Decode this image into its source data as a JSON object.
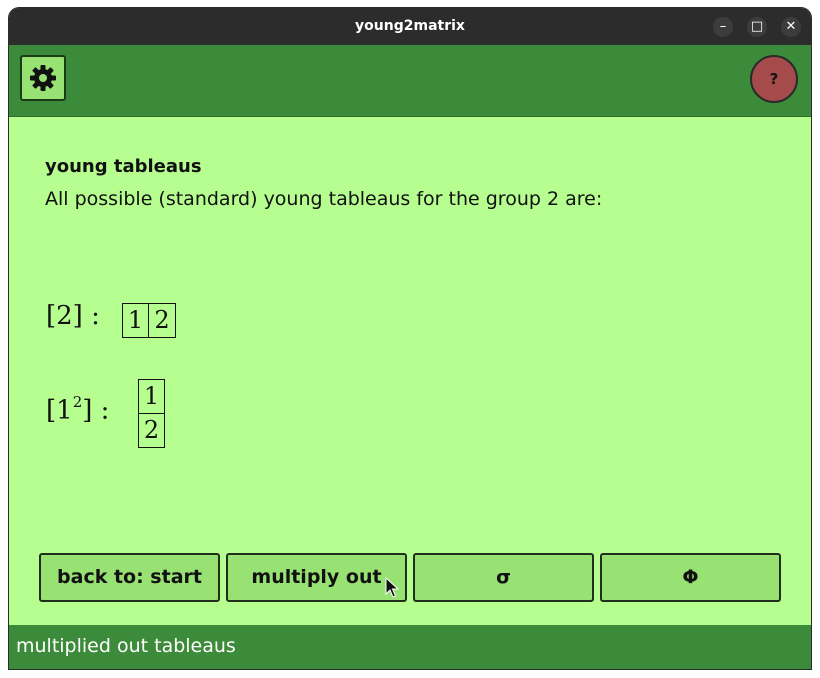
{
  "window": {
    "title": "young2matrix",
    "minimize_glyph": "–",
    "maximize_glyph": "□",
    "close_glyph": "✕"
  },
  "toolbar": {
    "settings_icon": "gear-icon",
    "help_label": "?"
  },
  "content": {
    "heading": "young tableaus",
    "description": "All possible (standard) young tableaus for the group 2 are:",
    "tableaux": [
      {
        "label": "[2] :",
        "cells": [
          "1",
          "2"
        ],
        "shape": "row"
      },
      {
        "label_base": "[1",
        "label_sup": "2",
        "label_end": "] :",
        "cells": [
          "1",
          "2"
        ],
        "shape": "column"
      }
    ]
  },
  "buttons": [
    {
      "label": "back to: start"
    },
    {
      "label": "multiply out"
    },
    {
      "label": "σ"
    },
    {
      "label": "Φ"
    }
  ],
  "status": {
    "text": "multiplied out tableaus"
  },
  "colors": {
    "background": "#b5fe8f",
    "bar": "#3c8b3a",
    "button": "#98e274",
    "help": "#a64b4b"
  }
}
